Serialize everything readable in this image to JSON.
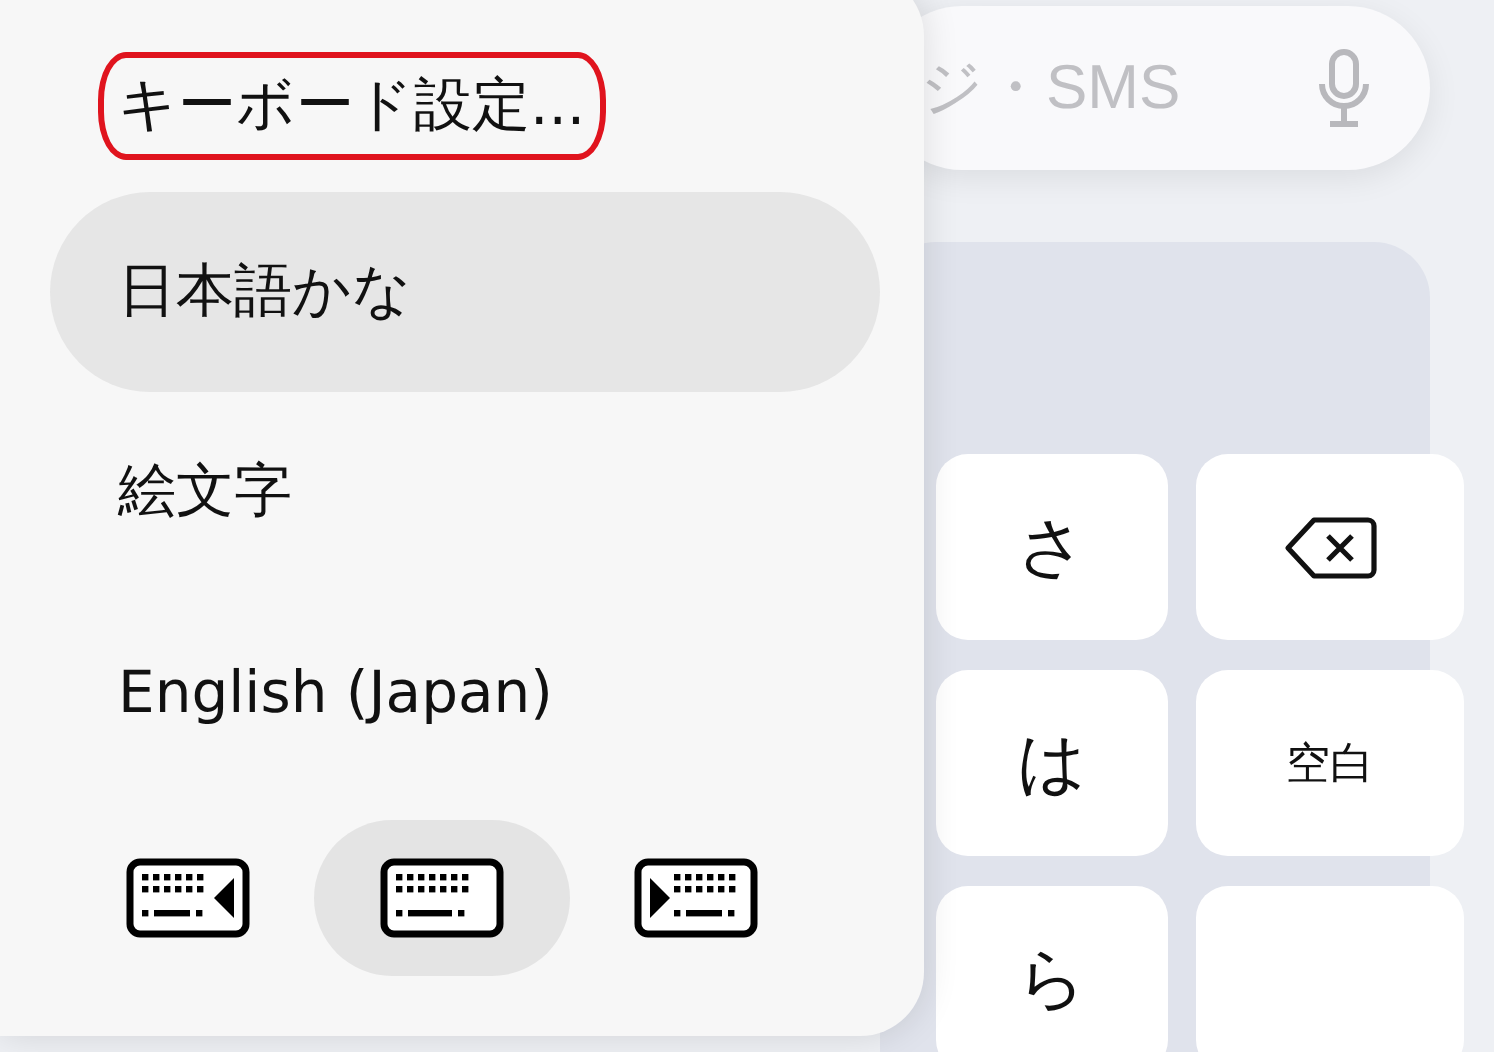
{
  "search": {
    "placeholder": "ジ・SMS"
  },
  "keyboard": {
    "keys": [
      {
        "kind": "char",
        "label": "さ"
      },
      {
        "kind": "delete"
      },
      {
        "kind": "char",
        "label": "は"
      },
      {
        "kind": "small",
        "label": "空白"
      },
      {
        "kind": "char",
        "label": "ら"
      },
      {
        "kind": "blank"
      }
    ]
  },
  "menu": {
    "items": [
      {
        "label": "キーボード設定...",
        "selected": false,
        "circled": true
      },
      {
        "label": "日本語かな",
        "selected": true,
        "circled": false
      },
      {
        "label": "絵文字",
        "selected": false,
        "circled": false
      },
      {
        "label": "English (Japan)",
        "selected": false,
        "circled": false
      }
    ],
    "modes": [
      {
        "kind": "left",
        "selected": false
      },
      {
        "kind": "full",
        "selected": true
      },
      {
        "kind": "right",
        "selected": false
      }
    ]
  }
}
